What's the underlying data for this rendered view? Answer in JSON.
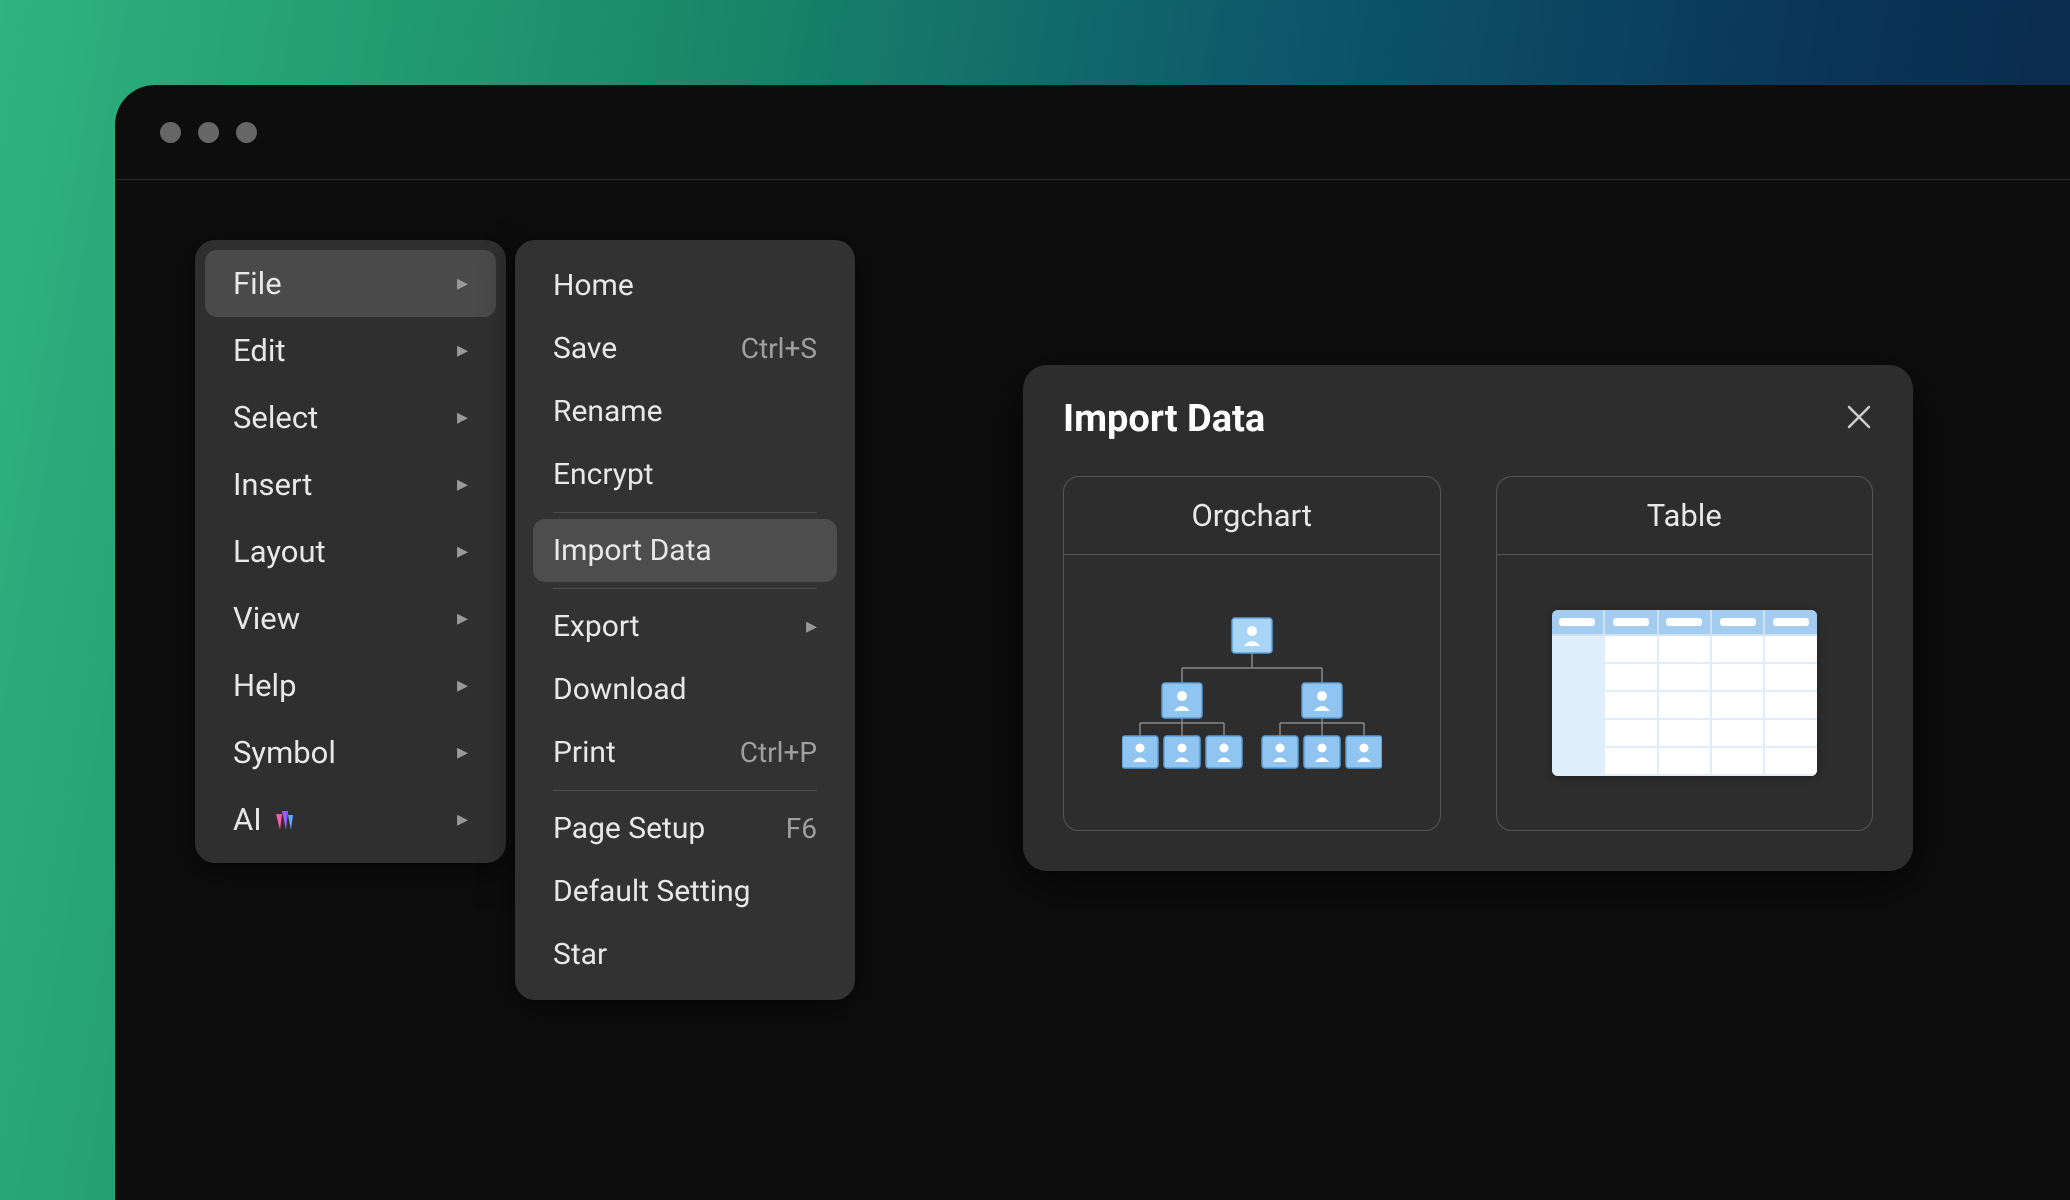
{
  "menu": {
    "primary": [
      {
        "label": "File",
        "hasSub": true,
        "active": true
      },
      {
        "label": "Edit",
        "hasSub": true
      },
      {
        "label": "Select",
        "hasSub": true
      },
      {
        "label": "Insert",
        "hasSub": true
      },
      {
        "label": "Layout",
        "hasSub": true
      },
      {
        "label": "View",
        "hasSub": true
      },
      {
        "label": "Help",
        "hasSub": true
      },
      {
        "label": "Symbol",
        "hasSub": true
      },
      {
        "label": "AI",
        "hasSub": true,
        "icon": "ai"
      }
    ],
    "secondary": [
      {
        "label": "Home"
      },
      {
        "label": "Save",
        "shortcut": "Ctrl+S"
      },
      {
        "label": "Rename"
      },
      {
        "label": "Encrypt"
      },
      {
        "divider": true
      },
      {
        "label": "Import Data",
        "active": true
      },
      {
        "divider": true
      },
      {
        "label": "Export",
        "hasSub": true
      },
      {
        "label": "Download"
      },
      {
        "label": "Print",
        "shortcut": "Ctrl+P"
      },
      {
        "divider": true
      },
      {
        "label": "Page Setup",
        "shortcut": "F6"
      },
      {
        "label": "Default Setting"
      },
      {
        "label": "Star"
      }
    ]
  },
  "dialog": {
    "title": "Import Data",
    "options": [
      {
        "label": "Orgchart",
        "illustration": "orgchart"
      },
      {
        "label": "Table",
        "illustration": "table"
      }
    ]
  }
}
